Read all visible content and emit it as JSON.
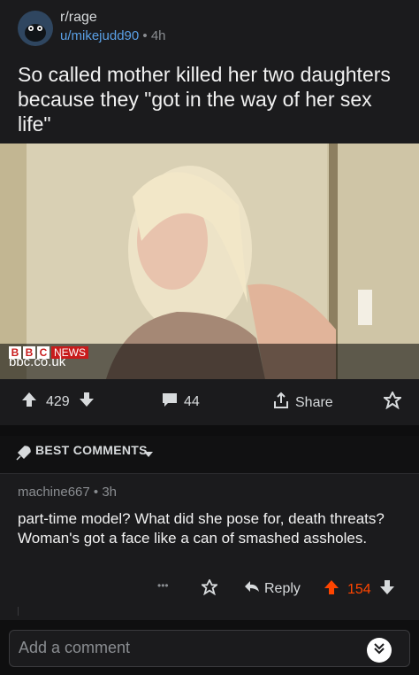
{
  "post": {
    "subreddit": "r/rage",
    "author": "u/mikejudd90",
    "separator": "•",
    "age": "4h",
    "title": "So called mother killed her two daughters because they \"got in the way of her sex life\""
  },
  "media": {
    "bbc_letters": [
      "B",
      "B",
      "C"
    ],
    "bbc_news_label": "NEWS",
    "domain": "bbc.co.uk"
  },
  "actions": {
    "upvotes": "429",
    "comments": "44",
    "share_label": "Share"
  },
  "comments_header": {
    "sort_label": "BEST COMMENTS"
  },
  "comment": {
    "author": "machine667",
    "separator": "•",
    "age": "3h",
    "body": "part-time model? What did she pose for, death threats? Woman's got a face like a can of smashed assholes.",
    "more_label": "•••",
    "reply_label": "Reply",
    "score": "154"
  },
  "composer": {
    "placeholder": "Add a comment"
  },
  "colors": {
    "upvote_active": "#ff4500",
    "link_blue": "#5aa0e6",
    "bbc_red": "#c81c1c"
  }
}
